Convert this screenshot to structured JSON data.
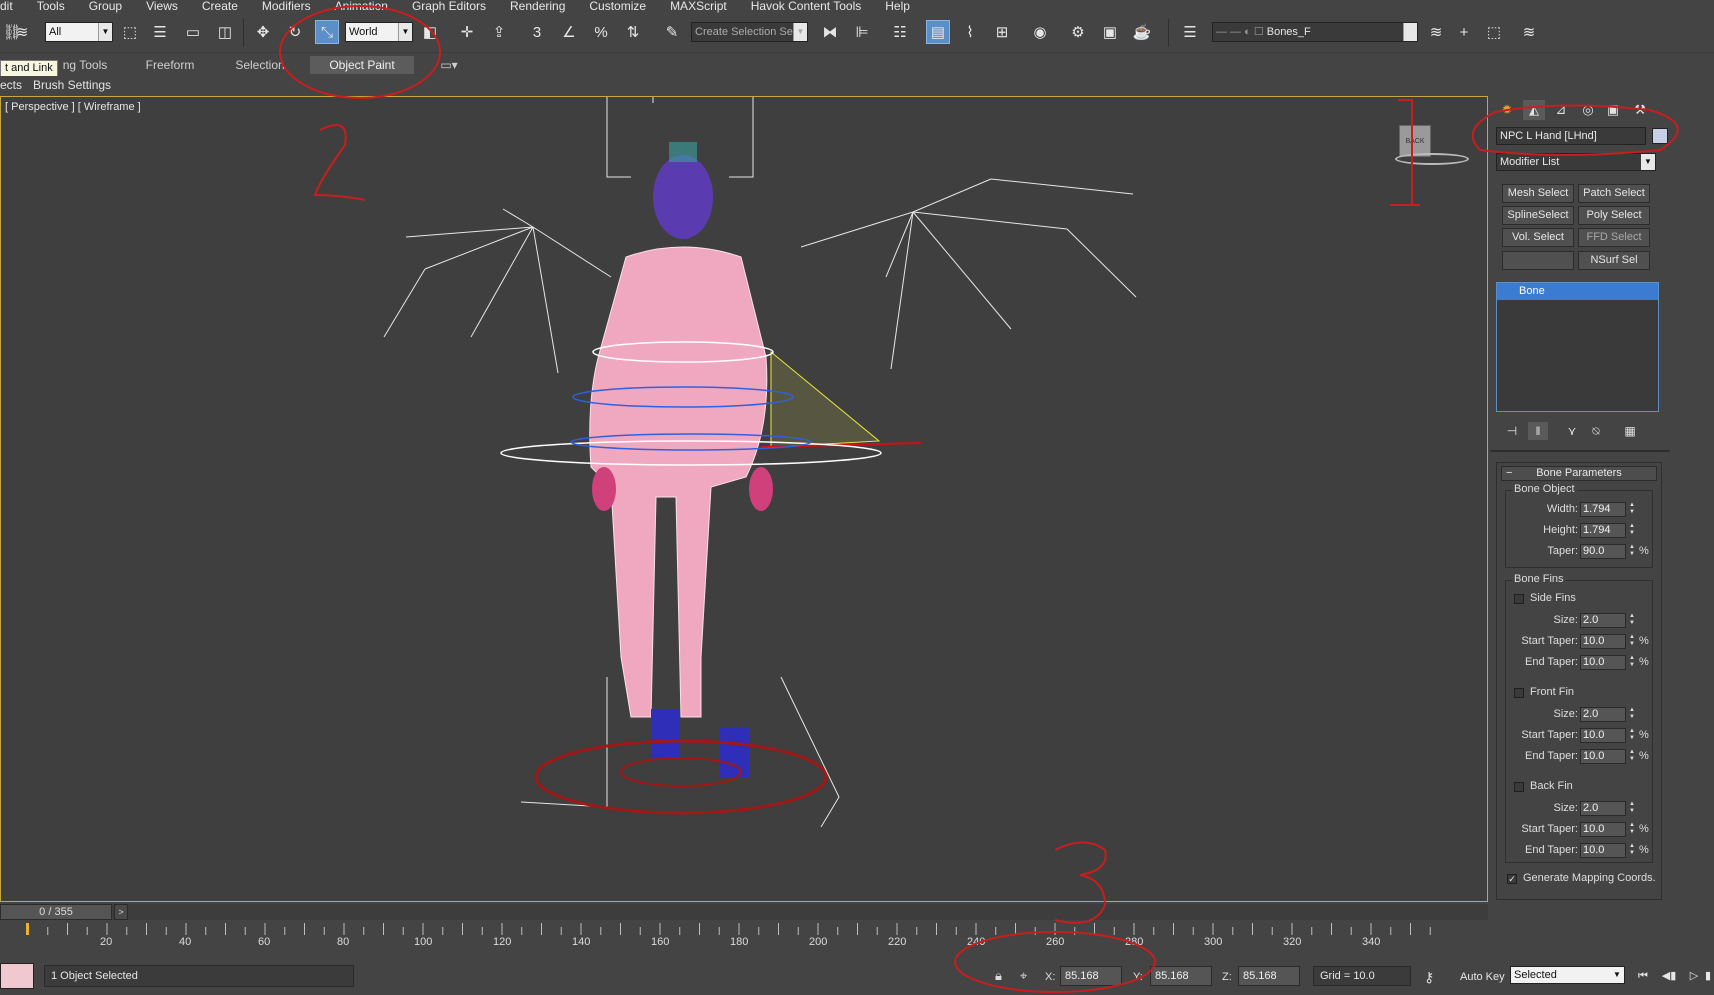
{
  "menu": [
    "dit",
    "Tools",
    "Group",
    "Views",
    "Create",
    "Modifiers",
    "Animation",
    "Graph Editors",
    "Rendering",
    "Customize",
    "MAXScript",
    "Havok Content Tools",
    "Help"
  ],
  "toolbar": {
    "filter_value": "All",
    "coord_system": "World",
    "named_selection_placeholder": "Create Selection Se",
    "layer_name": "Bones_F"
  },
  "ribbon": {
    "tabs": [
      "ng Tools",
      "Freeform",
      "Selection",
      "Object Paint"
    ],
    "active_tab": "Object Paint",
    "tooltip": "t and Link",
    "sub_items": [
      "ects",
      "Brush Settings"
    ]
  },
  "viewport": {
    "label": "[ Perspective ] [ Wireframe ]",
    "viewcube_label": "BACK"
  },
  "command_panel": {
    "object_name": "NPC L Hand [LHnd]",
    "modifier_list": "Modifier List",
    "modifier_buttons": [
      "Mesh Select",
      "Patch Select",
      "SplineSelect",
      "Poly Select",
      "Vol. Select",
      "FFD Select",
      "",
      "NSurf Sel"
    ],
    "stack_items": [
      "Bone"
    ],
    "rollout_title": "Bone Parameters",
    "bone_object": {
      "title": "Bone Object",
      "width_label": "Width:",
      "width": "1.794",
      "height_label": "Height:",
      "height": "1.794",
      "taper_label": "Taper:",
      "taper": "90.0"
    },
    "bone_fins": {
      "title": "Bone Fins",
      "side_fins": "Side Fins",
      "front_fin": "Front Fin",
      "back_fin": "Back Fin",
      "size_label": "Size:",
      "start_taper_label": "Start Taper:",
      "end_taper_label": "End Taper:",
      "side": {
        "size": "2.0",
        "start": "10.0",
        "end": "10.0"
      },
      "front": {
        "size": "2.0",
        "start": "10.0",
        "end": "10.0"
      },
      "back": {
        "size": "2.0",
        "start": "10.0",
        "end": "10.0"
      }
    },
    "gen_mapping": "Generate Mapping Coords.",
    "gen_mapping_checked": true,
    "percent": "%"
  },
  "timeline": {
    "frame_display": "0 / 355",
    "ticks": [
      "20",
      "40",
      "60",
      "80",
      "100",
      "120",
      "140",
      "160",
      "180",
      "200",
      "220",
      "240",
      "260",
      "280",
      "300",
      "320",
      "340"
    ]
  },
  "status": {
    "selection": "1 Object Selected",
    "x_label": "X:",
    "x": "85.168",
    "y_label": "Y:",
    "y": "85.168",
    "z_label": "Z:",
    "z": "85.168",
    "grid": "Grid = 10.0",
    "auto_key": "Auto Key",
    "key_mode": "Selected"
  },
  "annotations": [
    "1",
    "2",
    "3"
  ],
  "colors": {
    "accent": "#3b7bd1",
    "annotation": "#c81e1e",
    "viewport_border": "#c8a742",
    "mesh": "#f0a8c0"
  }
}
